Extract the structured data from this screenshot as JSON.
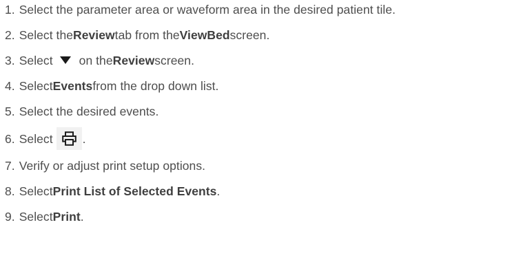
{
  "steps": [
    {
      "num": "1.",
      "text": "Select the parameter area or waveform area in the desired patient tile."
    },
    {
      "num": "2.",
      "t1": "Select the ",
      "b1": "Review",
      "t2": " tab from the ",
      "b2": "ViewBed",
      "t3": " screen."
    },
    {
      "num": "3.",
      "t1": "Select",
      "icon": "dropdown-triangle-icon",
      "t2": "on the ",
      "b1": "Review",
      "t3": " screen."
    },
    {
      "num": "4.",
      "t1": "Select ",
      "b1": "Events",
      "t2": " from the drop down list."
    },
    {
      "num": "5.",
      "text": "Select the desired events."
    },
    {
      "num": "6.",
      "t1": "Select",
      "icon": "printer-icon",
      "t2": "."
    },
    {
      "num": "7.",
      "text": "Verify or adjust print setup options."
    },
    {
      "num": "8.",
      "t1": "Select ",
      "b1": "Print List of Selected Events",
      "t2": "."
    },
    {
      "num": "9.",
      "t1": "Select ",
      "b1": "Print",
      "t2": "."
    }
  ],
  "colors": {
    "text": "#4d4d4d",
    "icon": "#1a1a1a",
    "icon_background": "#f1f1f1"
  }
}
